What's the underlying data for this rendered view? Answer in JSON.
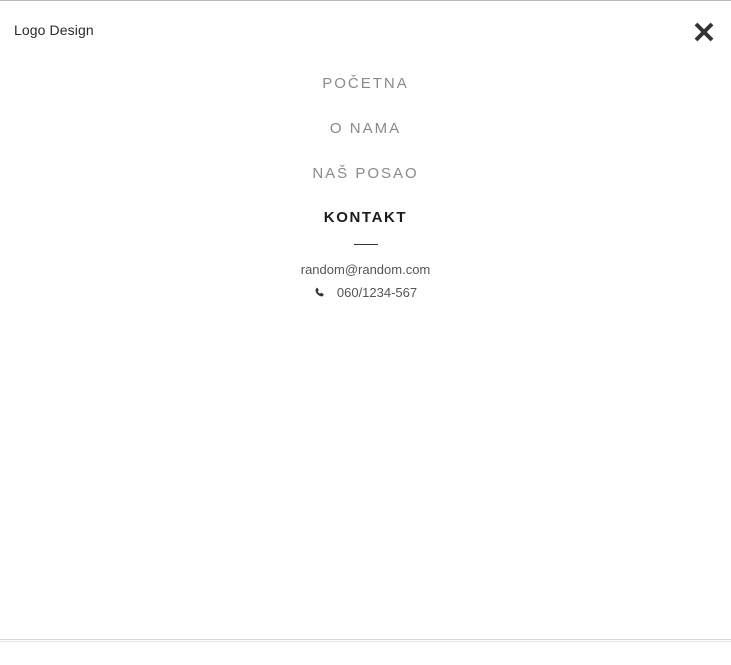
{
  "header": {
    "logo_text": "Logo Design",
    "close_icon": "close-icon"
  },
  "menu": {
    "items": [
      {
        "label": "POČETNA",
        "active": false
      },
      {
        "label": "O NAMA",
        "active": false
      },
      {
        "label": "NAŠ POSAO",
        "active": false
      },
      {
        "label": "KONTAKT",
        "active": true
      }
    ]
  },
  "contact": {
    "email": "random@random.com",
    "phone": "060/1234-567",
    "phone_icon": "phone-icon"
  },
  "colors": {
    "active_text": "#1b1b1b",
    "inactive_text": "#8a8a8a",
    "close_icon": "#333333"
  }
}
